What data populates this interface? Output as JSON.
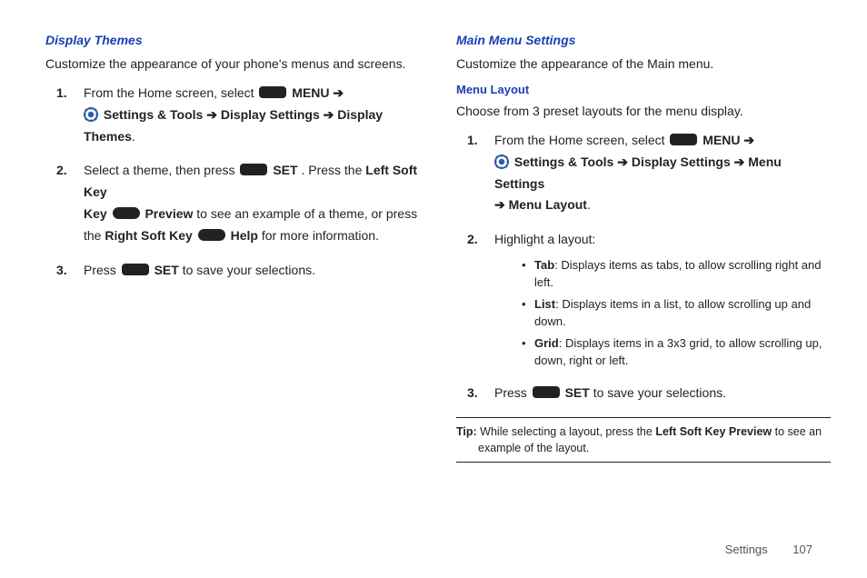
{
  "left": {
    "heading": "Display Themes",
    "intro": "Customize the appearance of your phone's menus and screens.",
    "step1_a": "From the Home screen, select ",
    "menu": "MENU",
    "settings_tools": "Settings & Tools",
    "display_settings": "Display Settings",
    "display_themes": "Display Themes",
    "step2_a": "Select a theme, then press ",
    "set": "SET",
    "step2_b": ". Press the ",
    "left_soft_key": "Left Soft Key",
    "preview": "Preview",
    "step2_c": " to see an example of a theme, or press the ",
    "right_soft_key": "Right Soft Key",
    "help": "Help",
    "step2_d": " for more information.",
    "step3_a": "Press ",
    "step3_b": " to save your selections."
  },
  "right": {
    "heading": "Main Menu Settings",
    "intro": "Customize the appearance of the Main menu.",
    "sub_heading": "Menu Layout",
    "intro2": "Choose from 3 preset layouts for the menu display.",
    "step1_a": "From the Home screen, select ",
    "menu": "MENU",
    "settings_tools": "Settings & Tools",
    "display_settings": "Display Settings",
    "menu_settings": "Menu Settings",
    "menu_layout": "Menu Layout",
    "step2": "Highlight a layout:",
    "bullets": {
      "tab_label": "Tab",
      "tab_text": ": Displays items as tabs, to allow scrolling right and left.",
      "list_label": "List",
      "list_text": ": Displays items in a list, to allow scrolling up and down.",
      "grid_label": "Grid",
      "grid_text": ": Displays items in a 3x3 grid, to allow scrolling up, down, right or left."
    },
    "step3_a": "Press ",
    "set": "SET",
    "step3_b": " to save your selections.",
    "tip_label": "Tip:",
    "tip_a": " While selecting a layout, press the ",
    "tip_key": "Left Soft Key Preview",
    "tip_b": " to see an example of the layout."
  },
  "footer": {
    "section": "Settings",
    "page": "107"
  }
}
